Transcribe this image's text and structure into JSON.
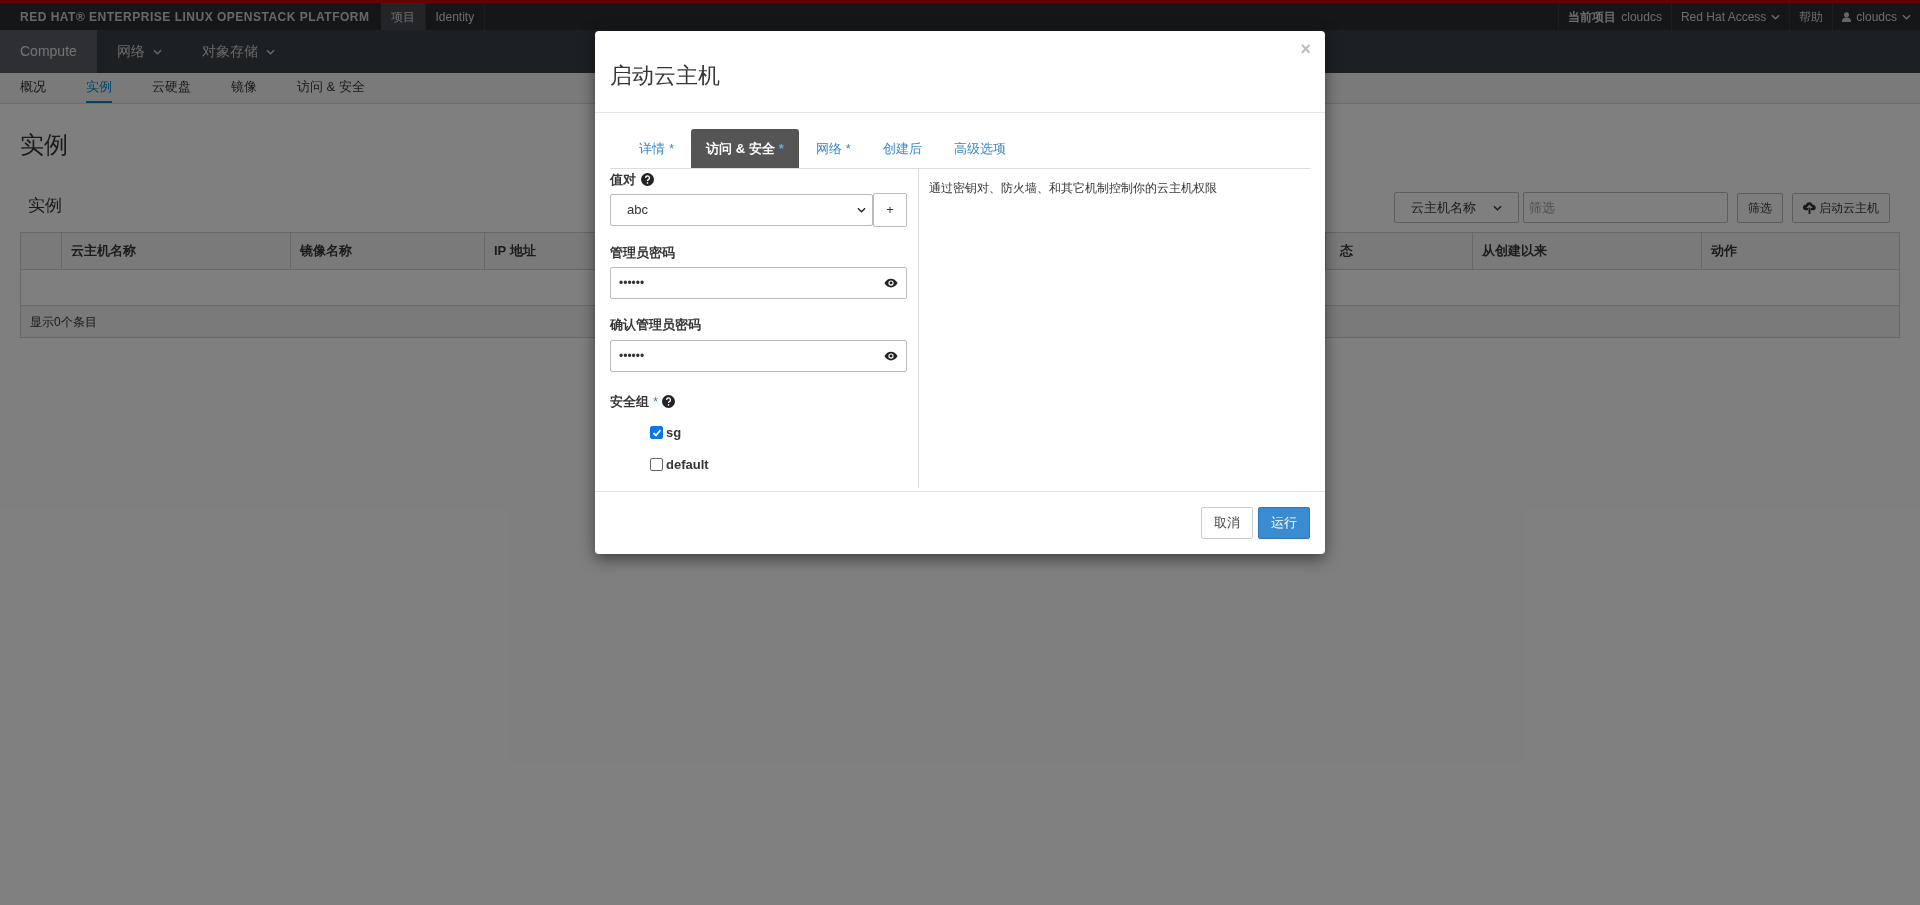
{
  "top_bar": {
    "brand": "RED HAT® ENTERPRISE LINUX OPENSTACK PLATFORM",
    "items": [
      {
        "label": "项目",
        "selected": true
      },
      {
        "label": "Identity",
        "selected": false
      }
    ],
    "right": [
      {
        "kind": "project",
        "label": "当前项目",
        "value": "cloudcs"
      },
      {
        "kind": "menu",
        "label": "Red Hat Access"
      },
      {
        "kind": "plain",
        "label": "帮助"
      },
      {
        "kind": "user",
        "label": "cloudcs"
      }
    ]
  },
  "nav": [
    {
      "label": "Compute",
      "selected": true,
      "dropdown": false
    },
    {
      "label": "网络",
      "selected": false,
      "dropdown": true
    },
    {
      "label": "对象存储",
      "selected": false,
      "dropdown": true
    }
  ],
  "subnav": [
    {
      "label": "概况",
      "selected": false
    },
    {
      "label": "实例",
      "selected": true
    },
    {
      "label": "云硬盘",
      "selected": false
    },
    {
      "label": "镜像",
      "selected": false
    },
    {
      "label": "访问 & 安全",
      "selected": false
    }
  ],
  "page_title": "实例",
  "section_title": "实例",
  "toolbar": {
    "filter_select": "云主机名称",
    "filter_placeholder": "筛选",
    "filter_button": "筛选",
    "launch_button": "启动云主机"
  },
  "table": {
    "columns": [
      "云主机名称",
      "镜像名称",
      "IP 地址",
      "态",
      "从创建以来",
      "动作"
    ],
    "footer": "显示0个条目"
  },
  "modal": {
    "title": "启动云主机",
    "close": "×",
    "tabs": [
      {
        "label": "详情",
        "required": true,
        "selected": false
      },
      {
        "label": "访问 & 安全",
        "required": true,
        "selected": true
      },
      {
        "label": "网络",
        "required": true,
        "selected": false
      },
      {
        "label": "创建后",
        "required": false,
        "selected": false
      },
      {
        "label": "高级选项",
        "required": false,
        "selected": false
      }
    ],
    "keypair": {
      "label": "值对",
      "value": "abc",
      "add": "+"
    },
    "password": {
      "label": "管理员密码",
      "value": "••••••"
    },
    "confirm_password": {
      "label": "确认管理员密码",
      "value": "••••••"
    },
    "security_groups": {
      "label": "安全组",
      "required_mark": "*",
      "items": [
        {
          "label": "sg",
          "checked": true
        },
        {
          "label": "default",
          "checked": false
        }
      ]
    },
    "help_text": "通过密钥对、防火墙、和其它机制控制你的云主机权限",
    "buttons": [
      {
        "kind": "cancel",
        "label": "取消"
      },
      {
        "kind": "primary",
        "label": "运行"
      }
    ]
  }
}
